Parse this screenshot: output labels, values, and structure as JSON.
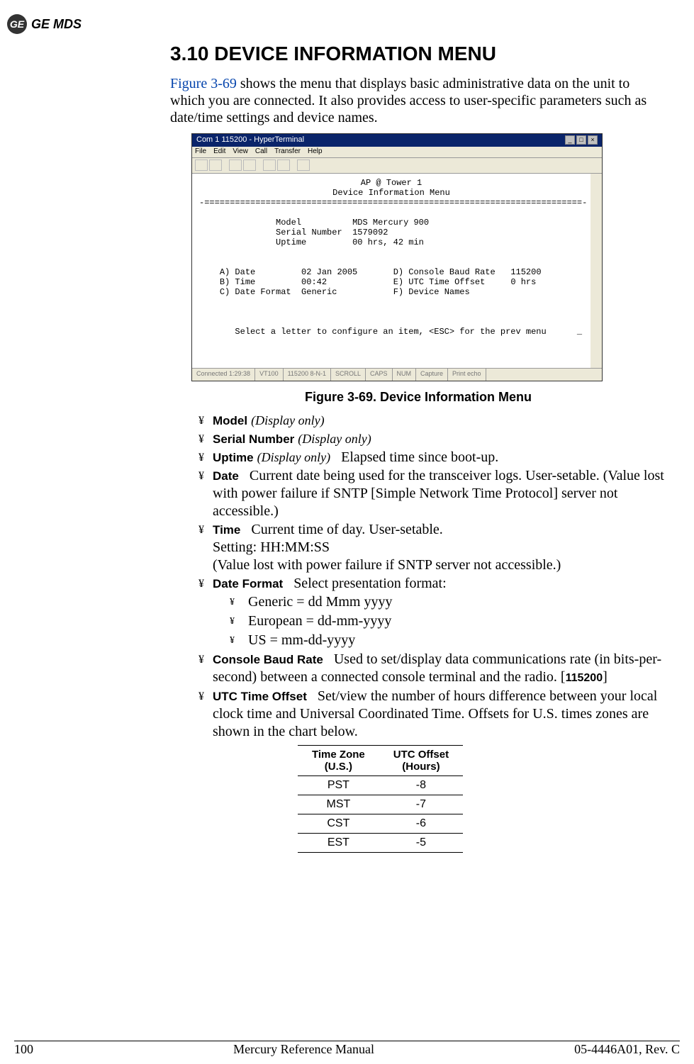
{
  "logo": {
    "ge": "GE",
    "mds": "GE MDS"
  },
  "section": {
    "number": "3.10",
    "title": "DEVICE INFORMATION MENU",
    "intro_link": "Figure 3-69",
    "intro_rest": " shows the menu that displays basic administrative data on the unit to which you are connected. It also provides access to user-specific parameters such as date/time settings and device names."
  },
  "terminal": {
    "title": "Com 1 115200 - HyperTerminal",
    "menus": [
      "File",
      "Edit",
      "View",
      "Call",
      "Transfer",
      "Help"
    ],
    "header_line1": "AP @ Tower 1",
    "header_line2": "Device Information Menu",
    "rule": "-==========================================================================-",
    "model_label": "Model",
    "model_value": "MDS Mercury 900",
    "serial_label": "Serial Number",
    "serial_value": "1579092",
    "uptime_label": "Uptime",
    "uptime_value": "00 hrs, 42 min",
    "rowA_label": "A) Date",
    "rowA_value": "02 Jan 2005",
    "rowD_label": "D) Console Baud Rate",
    "rowD_value": "115200",
    "rowB_label": "B) Time",
    "rowB_value": "00:42",
    "rowE_label": "E) UTC Time Offset",
    "rowE_value": "0 hrs",
    "rowC_label": "C) Date Format",
    "rowC_value": "Generic",
    "rowF_label": "F) Device Names",
    "prompt": "Select a letter to configure an item, <ESC> for the prev menu",
    "status": [
      "Connected 1:29:38",
      "VT100",
      "115200 8-N-1",
      "SCROLL",
      "CAPS",
      "NUM",
      "Capture",
      "Print echo"
    ]
  },
  "figure_caption": "Figure 3-69. Device Information Menu",
  "items": {
    "model": {
      "label": "Model",
      "tag": "(Display only)"
    },
    "serial": {
      "label": "Serial Number",
      "tag": "(Display only)"
    },
    "uptime": {
      "label": "Uptime",
      "tag": "(Display only)",
      "desc": "Elapsed time since boot-up."
    },
    "date": {
      "label": "Date",
      "desc": "Current date being used for the transceiver logs. User-setable. (Value lost with power failure if SNTP [Simple Network Time Protocol] server not accessible.)"
    },
    "time": {
      "label": "Time",
      "desc1": "Current time of day. User-setable.",
      "desc2": "Setting: HH:MM:SS",
      "desc3": "(Value lost with power failure if SNTP server not accessible.)"
    },
    "dateformat": {
      "label": "Date Format",
      "desc": "Select presentation format:",
      "opts": [
        "Generic = dd Mmm yyyy",
        "European = dd-mm-yyyy",
        "US = mm-dd-yyyy"
      ]
    },
    "baud": {
      "label": "Console Baud Rate",
      "desc_pre": "Used to set/display data communications rate (in bits-per-second) between a connected console terminal and the radio. [",
      "code": "115200",
      "desc_post": "]"
    },
    "utc": {
      "label": "UTC Time Offset",
      "desc": "Set/view the number of hours difference between your local clock time and Universal Coordinated Time. Offsets for U.S. times zones are shown in the chart below."
    }
  },
  "chart_data": {
    "type": "table",
    "title": "",
    "columns": [
      "Time Zone (U.S.)",
      "UTC Offset (Hours)"
    ],
    "rows": [
      {
        "zone": "PST",
        "offset": "-8"
      },
      {
        "zone": "MST",
        "offset": "-7"
      },
      {
        "zone": "CST",
        "offset": "-6"
      },
      {
        "zone": "EST",
        "offset": "-5"
      }
    ]
  },
  "footer": {
    "page": "100",
    "manual": "Mercury Reference Manual",
    "doc": "05-4446A01, Rev. C"
  }
}
